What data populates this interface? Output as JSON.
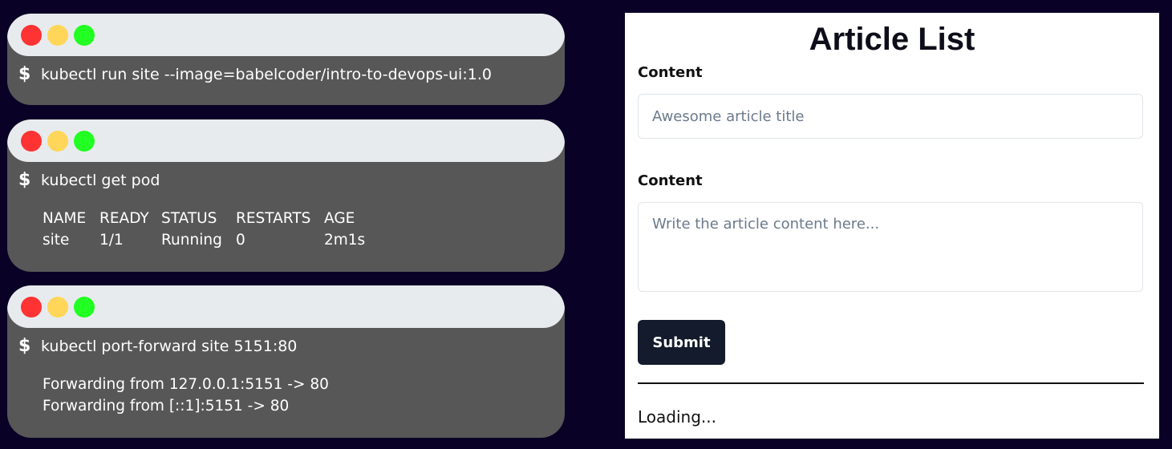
{
  "terminals": [
    {
      "prompt": "$",
      "command": "kubectl run site --image=babelcoder/intro-to-devops-ui:1.0"
    },
    {
      "prompt": "$",
      "command": "kubectl get pod",
      "table": {
        "headers": [
          "NAME",
          "READY",
          "STATUS",
          "RESTARTS",
          "AGE"
        ],
        "rows": [
          [
            "site",
            "1/1",
            "Running",
            "0",
            "2m1s"
          ]
        ]
      }
    },
    {
      "prompt": "$",
      "command": "kubectl port-forward site 5151:80",
      "output": [
        "Forwarding from 127.0.0.1:5151 -> 80",
        "Forwarding from [::1]:5151 -> 80"
      ]
    }
  ],
  "window_controls": {
    "close": "#ff3333",
    "minimize": "#ffd659",
    "maximize": "#22ff22"
  },
  "article_form": {
    "title": "Article List",
    "title_label": "Content",
    "title_placeholder": "Awesome article title",
    "content_label": "Content",
    "content_placeholder": "Write the article content here...",
    "submit_label": "Submit",
    "loading_text": "Loading..."
  },
  "colors": {
    "background": "#0a0226",
    "terminal_body": "#575757",
    "submit_button": "#131b2c"
  }
}
